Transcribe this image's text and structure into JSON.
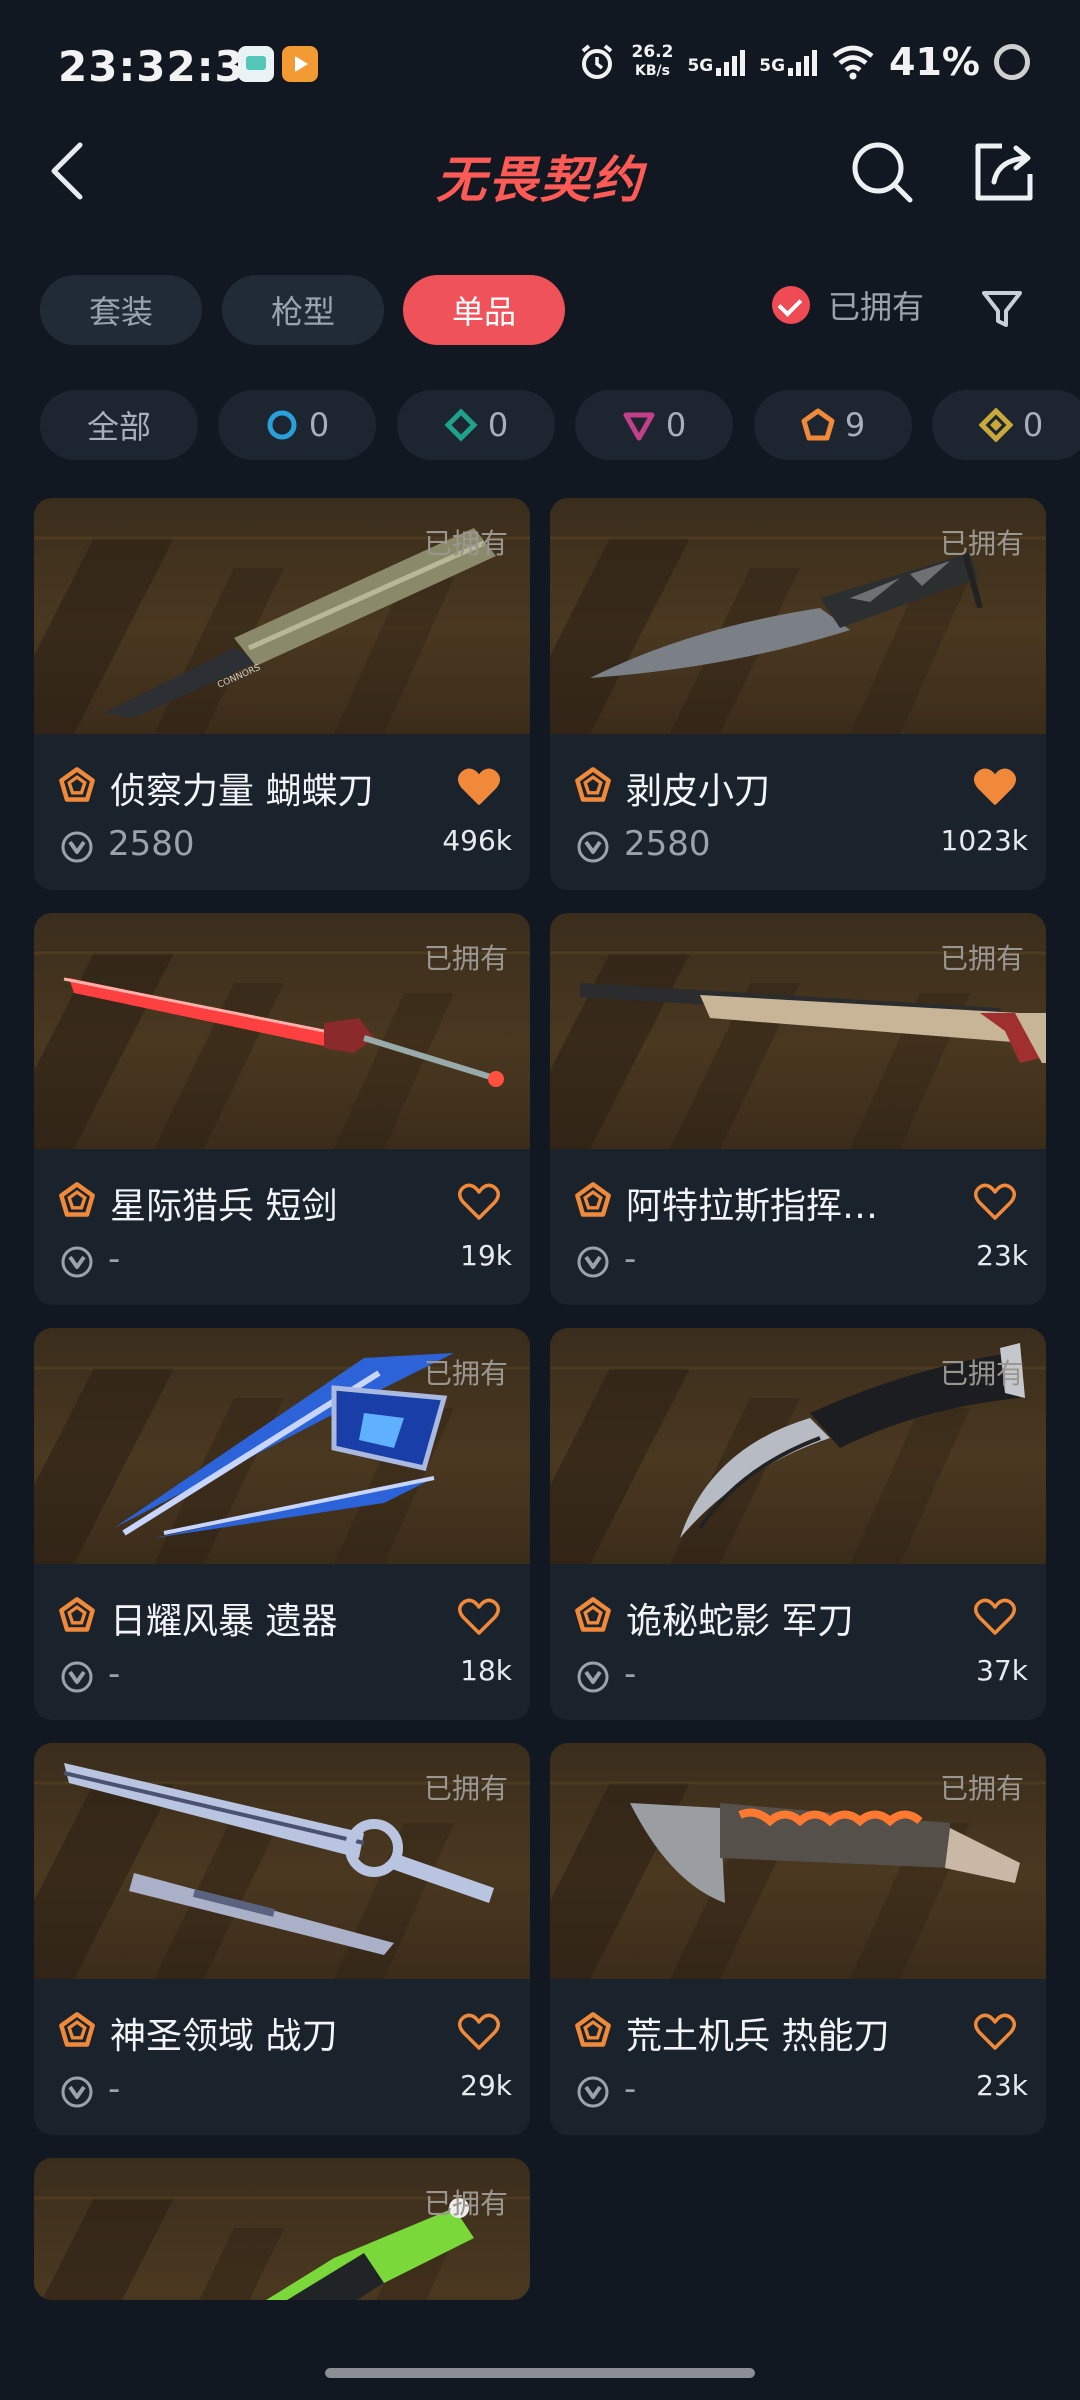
{
  "status_bar": {
    "time": "23:32:35",
    "speed_value": "26.2",
    "speed_unit": "KB/s",
    "net1": "5G",
    "net2": "5G",
    "battery": "41%"
  },
  "header": {
    "title": "无畏契约"
  },
  "tabs": [
    {
      "label": "套装",
      "active": false
    },
    {
      "label": "枪型",
      "active": false
    },
    {
      "label": "单品",
      "active": true
    }
  ],
  "owned_filter": {
    "label": "已拥有",
    "checked": true
  },
  "rarity_chips": [
    {
      "label": "全部",
      "count": ""
    },
    {
      "icon": "select-tier-icon",
      "count": "0",
      "color": "#2a9fd8"
    },
    {
      "icon": "deluxe-tier-icon",
      "count": "0",
      "color": "#1fa18c"
    },
    {
      "icon": "premium-tier-icon",
      "count": "0",
      "color": "#c23f8a"
    },
    {
      "icon": "exclusive-tier-icon",
      "count": "9",
      "color": "#f08a3a"
    },
    {
      "icon": "ultra-tier-icon",
      "count": "0",
      "color": "#c9a93b"
    }
  ],
  "cards": [
    {
      "name": "侦察力量 蝴蝶刀",
      "price": "2580",
      "likes": "496k",
      "owned_tag": "已拥有",
      "liked": true
    },
    {
      "name": "剥皮小刀",
      "price": "2580",
      "likes": "1023k",
      "owned_tag": "已拥有",
      "liked": true
    },
    {
      "name": "星际猎兵 短剑",
      "price": "-",
      "likes": "19k",
      "owned_tag": "已拥有",
      "liked": false
    },
    {
      "name": "阿特拉斯指挥…",
      "price": "-",
      "likes": "23k",
      "owned_tag": "已拥有",
      "liked": false
    },
    {
      "name": "日耀风暴 遗器",
      "price": "-",
      "likes": "18k",
      "owned_tag": "已拥有",
      "liked": false
    },
    {
      "name": "诡秘蛇影 军刀",
      "price": "-",
      "likes": "37k",
      "owned_tag": "已拥有",
      "liked": false
    },
    {
      "name": "神圣领域 战刀",
      "price": "-",
      "likes": "29k",
      "owned_tag": "已拥有",
      "liked": false
    },
    {
      "name": "荒土机兵 热能刀",
      "price": "-",
      "likes": "23k",
      "owned_tag": "已拥有",
      "liked": false
    },
    {
      "name": "",
      "price": "",
      "likes": "",
      "owned_tag": "已拥有",
      "liked": false
    }
  ],
  "colors": {
    "background": "#111821",
    "accent": "#f0525a",
    "title": "#ff5b56",
    "heart": "#f08a3a",
    "exclusive_tier": "#f08a3a"
  }
}
